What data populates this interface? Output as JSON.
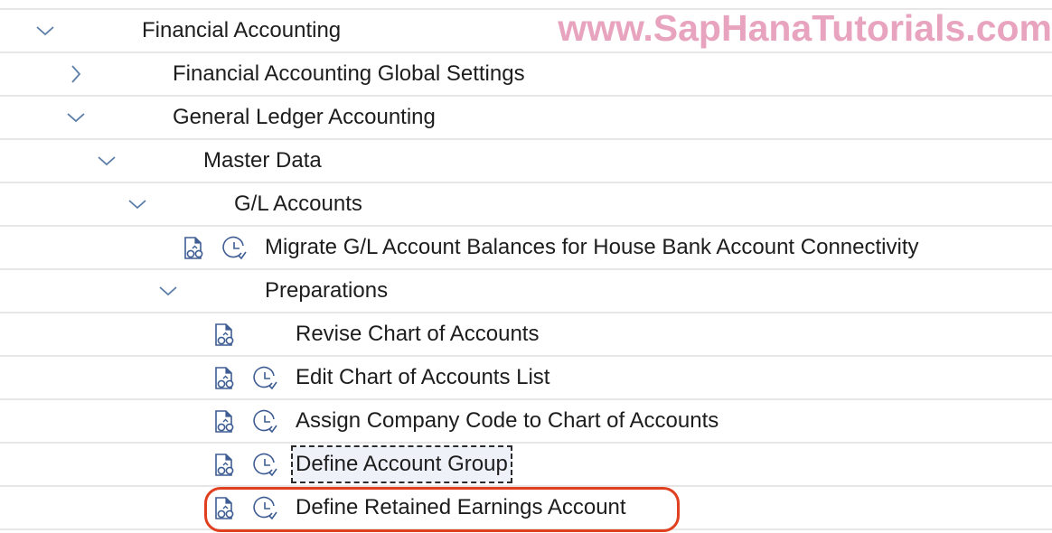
{
  "watermark": "www.SapHanaTutorials.com",
  "colors": {
    "chevron": "#5b7ea8",
    "icon": "#3f5d94",
    "highlight_ring": "#e0401f",
    "watermark": "#e8a4be",
    "divider": "#e6e6e6"
  },
  "tree": [
    {
      "label": "Financial Accounting",
      "level": 0,
      "expander": "chevron-down-icon",
      "icons": []
    },
    {
      "label": "Financial Accounting Global Settings",
      "level": 1,
      "expander": "chevron-right-icon",
      "icons": []
    },
    {
      "label": "General Ledger Accounting",
      "level": 1,
      "expander": "chevron-down-icon",
      "icons": []
    },
    {
      "label": "Master Data",
      "level": 2,
      "expander": "chevron-down-icon",
      "icons": []
    },
    {
      "label": "G/L Accounts",
      "level": 3,
      "expander": "chevron-down-icon",
      "icons": []
    },
    {
      "label": "Migrate G/L Account Balances for House Bank Account Connectivity",
      "level": 4,
      "expander": null,
      "icons": [
        "document-glasses-icon",
        "clock-check-icon"
      ]
    },
    {
      "label": "Preparations",
      "level": 4,
      "expander": "chevron-down-icon",
      "icons": []
    },
    {
      "label": "Revise Chart of Accounts",
      "level": 5,
      "expander": null,
      "icons": [
        "document-glasses-icon"
      ]
    },
    {
      "label": "Edit Chart of Accounts List",
      "level": 5,
      "expander": null,
      "icons": [
        "document-glasses-icon",
        "clock-check-icon"
      ]
    },
    {
      "label": "Assign Company Code to Chart of Accounts",
      "level": 5,
      "expander": null,
      "icons": [
        "document-glasses-icon",
        "clock-check-icon"
      ]
    },
    {
      "label": "Define Account Group",
      "level": 5,
      "expander": null,
      "icons": [
        "document-glasses-icon",
        "clock-check-icon"
      ],
      "focused": true
    },
    {
      "label": "Define Retained Earnings Account",
      "level": 5,
      "expander": null,
      "icons": [
        "document-glasses-icon",
        "clock-check-icon"
      ],
      "highlighted": true
    }
  ]
}
